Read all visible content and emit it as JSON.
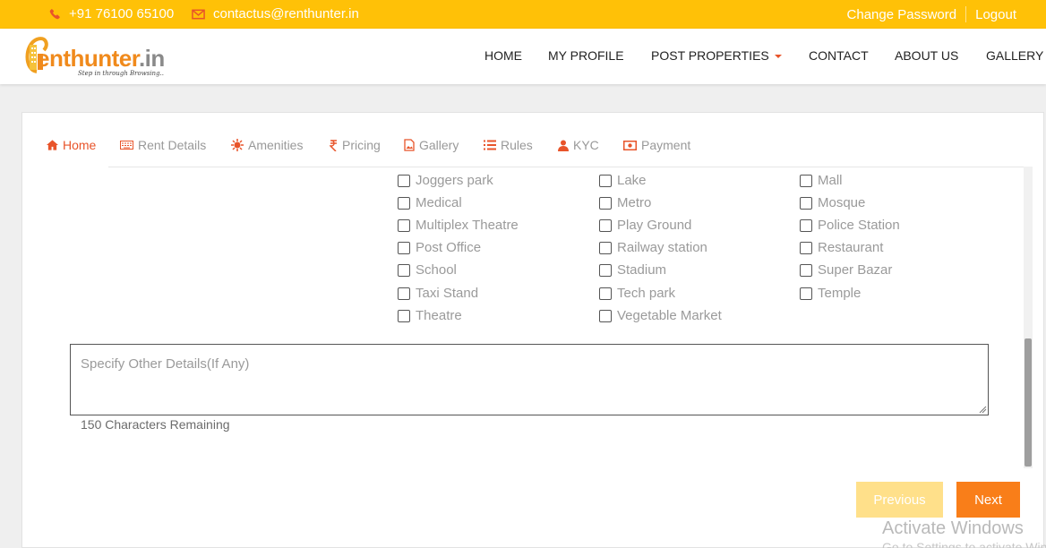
{
  "topbar": {
    "phone": "+91 76100 65100",
    "email": "contactus@renthunter.in",
    "change_password": "Change Password",
    "logout": "Logout",
    "phone_icon": "phone-icon",
    "email_icon": "envelope-icon"
  },
  "header": {
    "logo_brand": "enthunter",
    "logo_domain": ".in",
    "logo_tagline": "Step in through Browsing..",
    "nav": {
      "home": "HOME",
      "my_profile": "MY PROFILE",
      "post_properties": "POST PROPERTIES",
      "contact": "CONTACT",
      "about_us": "ABOUT US",
      "gallery": "GALLERY"
    }
  },
  "tabs": [
    {
      "label": "Home",
      "icon": "home-icon"
    },
    {
      "label": "Rent Details",
      "icon": "keyboard-icon"
    },
    {
      "label": "Amenities",
      "icon": "sun-icon"
    },
    {
      "label": "Pricing",
      "icon": "rupee-icon"
    },
    {
      "label": "Gallery",
      "icon": "image-icon"
    },
    {
      "label": "Rules",
      "icon": "list-icon"
    },
    {
      "label": "KYC",
      "icon": "user-icon"
    },
    {
      "label": "Payment",
      "icon": "money-icon"
    }
  ],
  "amenities": {
    "col1": [
      "Joggers park",
      "Medical",
      "Multiplex Theatre",
      "Post Office",
      "School",
      "Taxi Stand",
      "Theatre"
    ],
    "col2": [
      "Lake",
      "Metro",
      "Play Ground",
      "Railway station",
      "Stadium",
      "Tech park",
      "Vegetable Market"
    ],
    "col3": [
      "Mall",
      "Mosque",
      "Police Station",
      "Restaurant",
      "Super Bazar",
      "Temple"
    ]
  },
  "other_details": {
    "placeholder": "Specify Other Details(If Any)",
    "remaining": "150 Characters Remaining"
  },
  "buttons": {
    "previous": "Previous",
    "next": "Next"
  },
  "watermark": {
    "line1": "Activate Windows",
    "line2": "Go to Settings to activate Windows."
  },
  "colors": {
    "topbar": "#ffc107",
    "accent": "#e8542a",
    "next_button": "#f97e19",
    "previous_button": "#ffe08a"
  }
}
